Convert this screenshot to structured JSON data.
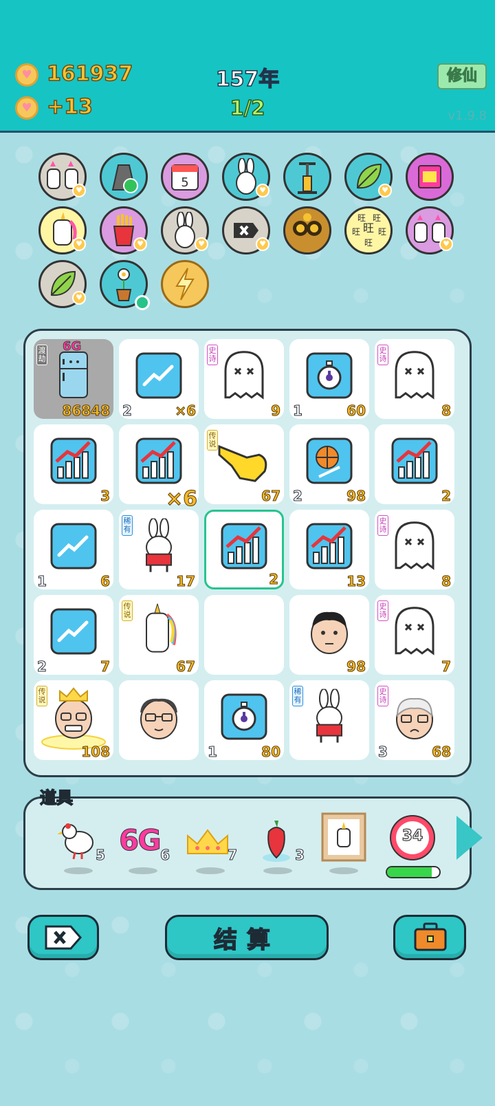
{
  "header": {
    "coins": "161937",
    "coin_rate": "+13",
    "year": "157年",
    "progress": "1/2",
    "mode_button": "修仙",
    "version": "v1.9.8"
  },
  "collection_icons": [
    "twin-unicorns-icon",
    "recycle-bag-icon",
    "calendar-icon",
    "rabbit-icon",
    "pump-icon",
    "leaf-icon",
    "boombox-icon",
    "unicorn-icon",
    "fries-icon",
    "rabbit-icon",
    "remove-icon",
    "cat-with-glasses-icon",
    "wang-text-icon",
    "twin-unicorns-icon",
    "leaf-icon",
    "flower-pot-icon",
    "lightning-icon"
  ],
  "calendar_day": "5",
  "wang_char": "旺",
  "board": {
    "cells": [
      {
        "icon": "fridge-icon",
        "tag": "渡劫",
        "label_top": "6G",
        "num_right": "86848",
        "num_left": "",
        "mult": ""
      },
      {
        "icon": "trend-icon",
        "tag": "",
        "num_right": "",
        "num_left": "2",
        "mult": "×6"
      },
      {
        "icon": "ghost-icon",
        "tag": "史诗",
        "num_right": "9",
        "num_left": "",
        "mult": ""
      },
      {
        "icon": "stopwatch-icon",
        "tag": "",
        "num_right": "60",
        "num_left": "1",
        "mult": ""
      },
      {
        "icon": "ghost-icon",
        "tag": "史诗",
        "num_right": "8",
        "num_left": "",
        "mult": ""
      },
      {
        "icon": "growth-chart-icon",
        "tag": "",
        "num_right": "3",
        "num_left": "",
        "mult": ""
      },
      {
        "icon": "growth-chart-icon",
        "tag": "",
        "num_right": "",
        "num_left": "",
        "mult": "×6"
      },
      {
        "icon": "pointing-hand-icon",
        "tag": "传说",
        "num_right": "67",
        "num_left": "",
        "mult": ""
      },
      {
        "icon": "basketball-icon",
        "tag": "",
        "num_right": "98",
        "num_left": "2",
        "mult": ""
      },
      {
        "icon": "growth-chart-icon",
        "tag": "",
        "num_right": "2",
        "num_left": "",
        "mult": ""
      },
      {
        "icon": "trend-icon",
        "tag": "",
        "num_right": "6",
        "num_left": "1",
        "mult": ""
      },
      {
        "icon": "rabbit-book-icon",
        "tag": "稀有",
        "num_right": "17",
        "num_left": "",
        "mult": ""
      },
      {
        "icon": "growth-chart-icon",
        "tag": "",
        "num_right": "2",
        "num_left": "",
        "mult": "",
        "selected": true
      },
      {
        "icon": "growth-chart-icon",
        "tag": "",
        "num_right": "13",
        "num_left": "",
        "mult": ""
      },
      {
        "icon": "ghost-icon",
        "tag": "史诗",
        "num_right": "8",
        "num_left": "",
        "mult": ""
      },
      {
        "icon": "trend-icon",
        "tag": "",
        "num_right": "7",
        "num_left": "2",
        "mult": ""
      },
      {
        "icon": "unicorn-icon",
        "tag": "传说",
        "num_right": "67",
        "num_left": "",
        "mult": ""
      },
      {
        "icon": "",
        "tag": "",
        "num_right": "",
        "num_left": "",
        "mult": ""
      },
      {
        "icon": "man-face-icon",
        "tag": "",
        "num_right": "98",
        "num_left": "",
        "mult": ""
      },
      {
        "icon": "ghost-icon",
        "tag": "史诗",
        "num_right": "7",
        "num_left": "",
        "mult": ""
      },
      {
        "icon": "king-face-icon",
        "tag": "传说",
        "num_right": "108",
        "num_left": "",
        "mult": ""
      },
      {
        "icon": "glasses-man-icon",
        "tag": "",
        "num_right": "",
        "num_left": "",
        "mult": ""
      },
      {
        "icon": "stopwatch-icon",
        "tag": "",
        "num_right": "80",
        "num_left": "1",
        "mult": ""
      },
      {
        "icon": "rabbit-book-icon",
        "tag": "稀有",
        "num_right": "",
        "num_left": "",
        "mult": ""
      },
      {
        "icon": "old-man-face-icon",
        "tag": "史诗",
        "num_right": "68",
        "num_left": "3",
        "mult": ""
      }
    ]
  },
  "props": {
    "title": "道具",
    "items": [
      {
        "icon": "dove-icon",
        "count": "5"
      },
      {
        "icon": "6g-icon",
        "label": "6G",
        "count": "6"
      },
      {
        "icon": "crown-icon",
        "count": "7"
      },
      {
        "icon": "chili-icon",
        "count": "3"
      },
      {
        "icon": "unicorn-frame-icon",
        "count": ""
      },
      {
        "icon": "timer-badge-icon",
        "label": "34",
        "count": "",
        "progress": 0.85
      }
    ]
  },
  "buttons": {
    "remove": "remove-icon",
    "settle": "结算",
    "bag": "briefcase-icon"
  }
}
